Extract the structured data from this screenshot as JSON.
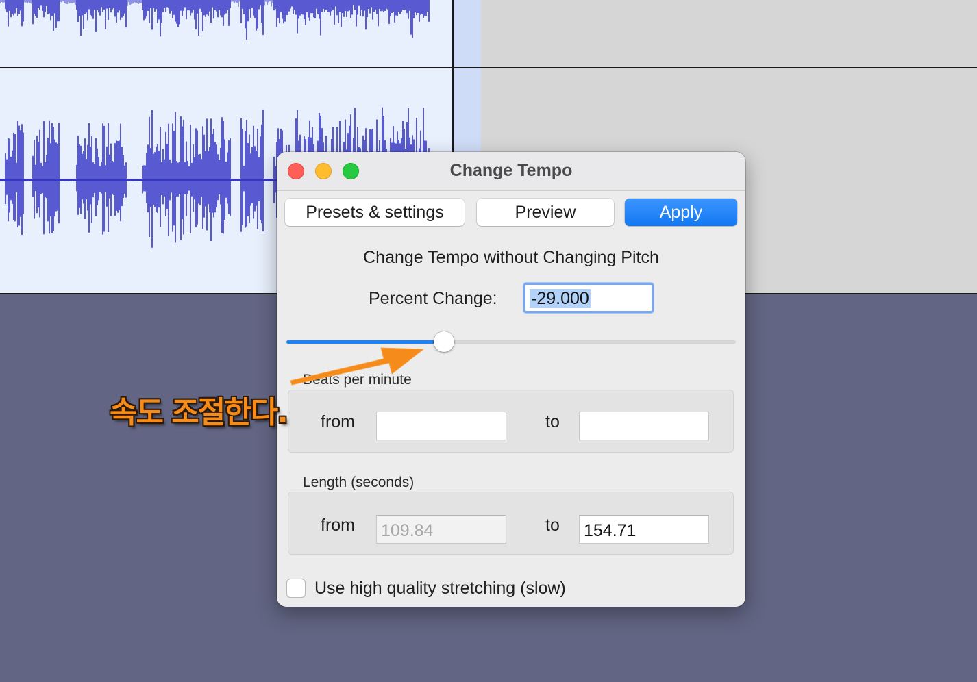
{
  "dialog": {
    "title": "Change Tempo",
    "window_controls": [
      "close-icon",
      "minimize-icon",
      "zoom-icon"
    ],
    "buttons": {
      "presets": "Presets & settings",
      "preview": "Preview",
      "apply": "Apply"
    },
    "heading": "Change Tempo without Changing Pitch",
    "percent_change": {
      "label": "Percent Change:",
      "value": "-29.000"
    },
    "slider": {
      "value_fraction": 0.35
    },
    "bpm": {
      "group_label": "Beats per minute",
      "from_label": "from",
      "from_value": "",
      "to_label": "to",
      "to_value": ""
    },
    "length": {
      "group_label": "Length (seconds)",
      "from_label": "from",
      "from_value": "109.84",
      "to_label": "to",
      "to_value": "154.71"
    },
    "high_quality": {
      "label": "Use high quality stretching (slow)",
      "checked": false
    }
  },
  "annotation": {
    "text": "속도 조절한다.",
    "color": "#f58b1a"
  },
  "colors": {
    "waveform": "#3535c8",
    "accent": "#1a82fb",
    "background": "#626583"
  }
}
